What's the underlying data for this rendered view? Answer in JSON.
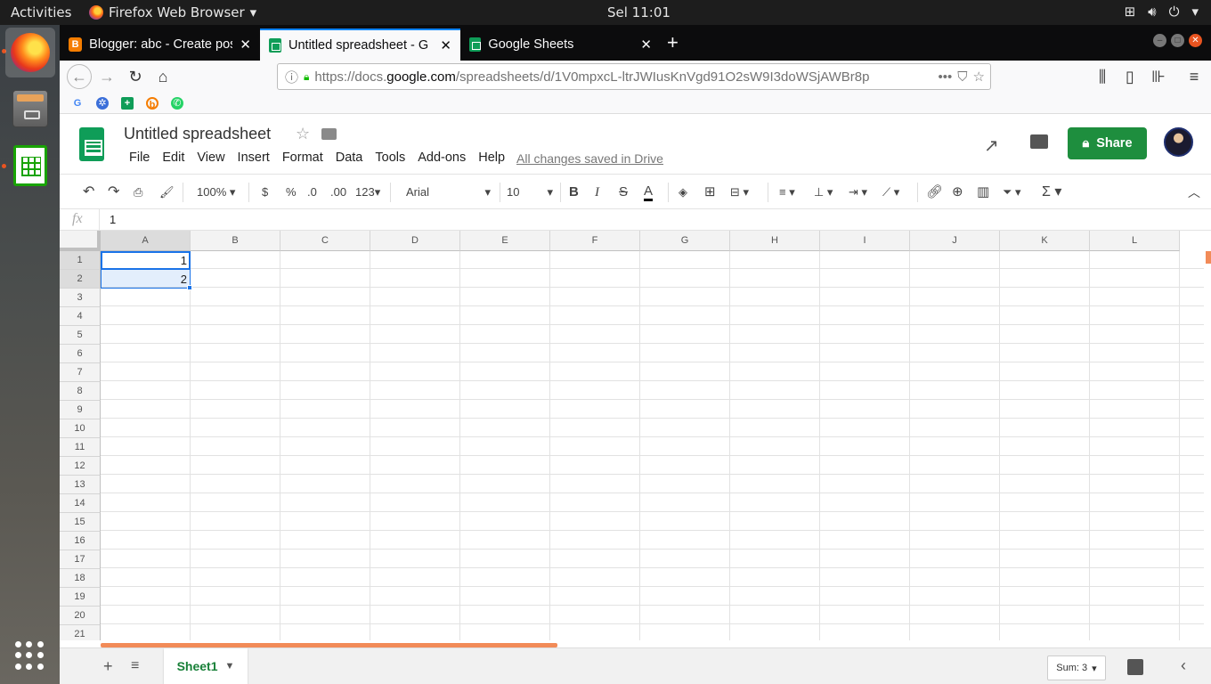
{
  "system_bar": {
    "activities": "Activities",
    "app_name": "Firefox Web Browser",
    "clock": "Sel 11:01"
  },
  "browser": {
    "tabs": [
      {
        "title": "Blogger: abc - Create pos"
      },
      {
        "title": "Untitled spreadsheet - G"
      },
      {
        "title": "Google Sheets"
      }
    ],
    "url_prefix": "https://docs.",
    "url_host": "google.com",
    "url_path": "/spreadsheets/d/1V0mpxcL-ltrJWIusKnVgd91O2sW9I3doWSjAWBr8p"
  },
  "sheets": {
    "title": "Untitled spreadsheet",
    "menu": [
      "File",
      "Edit",
      "View",
      "Insert",
      "Format",
      "Data",
      "Tools",
      "Add-ons",
      "Help"
    ],
    "saved_status": "All changes saved in Drive",
    "share_label": "Share",
    "toolbar": {
      "zoom": "100%",
      "currency": "$",
      "percent": "%",
      "dec_less": ".0",
      "dec_more": ".00",
      "number_format": "123",
      "font": "Arial",
      "font_size": "10",
      "bold": "B",
      "italic": "I",
      "strike": "S",
      "text_color": "A",
      "sigma": "Σ"
    },
    "formula_label": "fx",
    "formula_value": "1",
    "columns": [
      "A",
      "B",
      "C",
      "D",
      "E",
      "F",
      "G",
      "H",
      "I",
      "J",
      "K",
      "L"
    ],
    "rows": [
      "1",
      "2",
      "3",
      "4",
      "5",
      "6",
      "7",
      "8",
      "9",
      "10",
      "11",
      "12",
      "13",
      "14",
      "15",
      "16",
      "17",
      "18",
      "19",
      "20",
      "21"
    ],
    "cells": {
      "A1": "1",
      "A2": "2"
    },
    "sheet_tab": "Sheet1",
    "sum": "Sum: 3"
  },
  "colors": {
    "sheets_green": "#0f9d58",
    "share_green": "#1e8e3e",
    "selection_blue": "#1a73e8",
    "scroll_orange": "#f28b58"
  }
}
